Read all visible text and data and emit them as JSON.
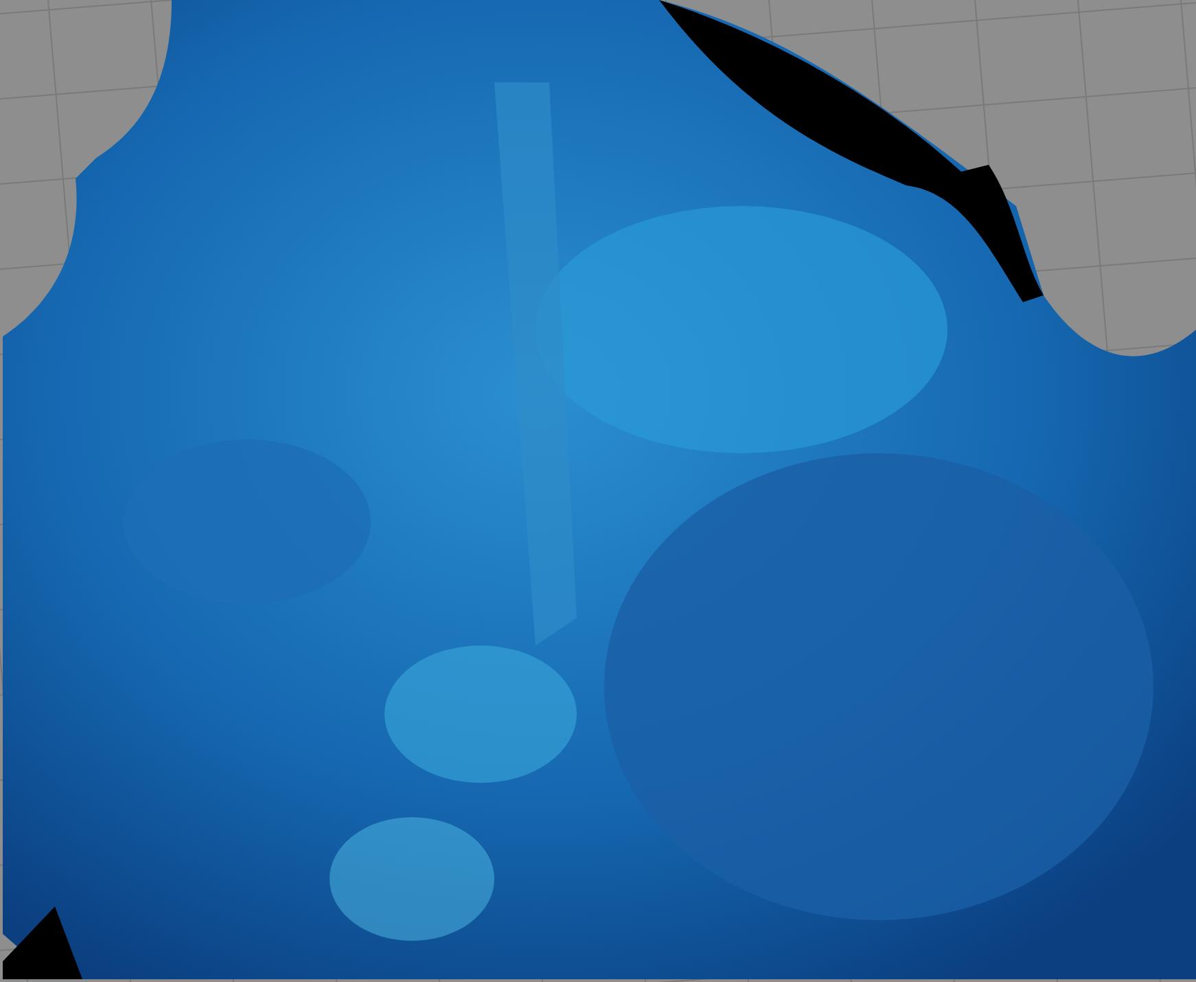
{
  "viewport": {
    "show_grid": true
  }
}
